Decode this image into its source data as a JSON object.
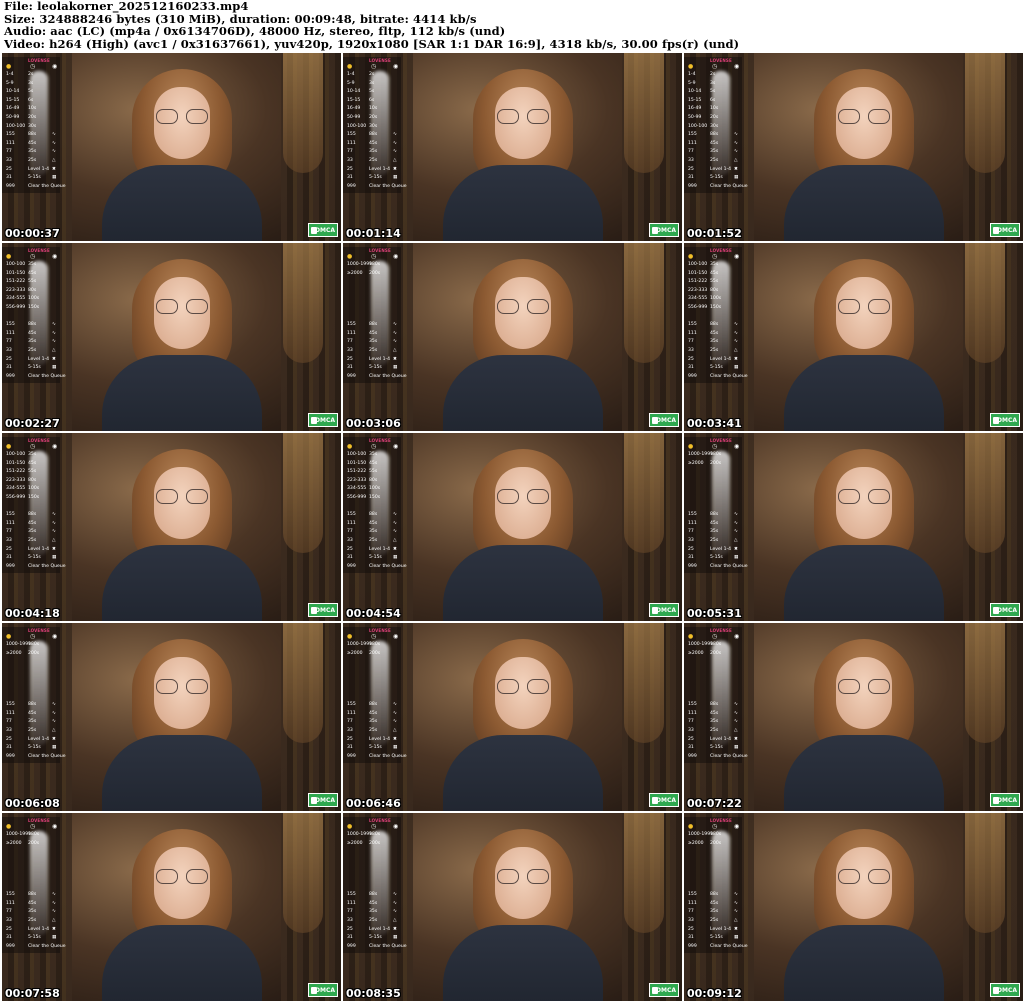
{
  "header": {
    "line1": "File: leolakorner_202512160233.mp4",
    "line2": "Size: 324888246 bytes (310 MiB), duration: 00:09:48, bitrate: 4414 kb/s",
    "line3": "Audio: aac (LC) (mp4a / 0x6134706D), 48000 Hz, stereo, fltp, 112 kb/s (und)",
    "line4": "Video: h264 (High) (avc1 / 0x31637661), yuv420p, 1920x1080 [SAR 1:1 DAR 16:9], 4318 kb/s, 30.00 fps(r) (und)"
  },
  "brand_text": "LOVENSE",
  "badge_text": "DMCA",
  "icons": {
    "coin": "coin-icon",
    "clock": "clock-icon",
    "wave": "vibe-icon",
    "lock": "lock-icon"
  },
  "colors": {
    "badge": "#2fa84f",
    "brand": "#e0407a",
    "coin": "#f2c029"
  },
  "thumbnails": [
    {
      "time": "00:00:37",
      "rows": [
        [
          "1-4",
          "2s",
          ""
        ],
        [
          "5-9",
          "3s",
          ""
        ],
        [
          "10-14",
          "5s",
          ""
        ],
        [
          "15-15",
          "6s",
          ""
        ],
        [
          "16-49",
          "10s",
          ""
        ],
        [
          "50-99",
          "20s",
          ""
        ],
        [
          "100-100",
          "30s",
          ""
        ],
        [
          "155",
          "88s",
          "∿"
        ],
        [
          "111",
          "45s",
          "∿"
        ],
        [
          "77",
          "35s",
          "∿"
        ],
        [
          "33",
          "25s",
          "△"
        ],
        [
          "25",
          "Level 1-4",
          "✖"
        ],
        [
          "31",
          "5-15s",
          "▦"
        ],
        [
          "999",
          "Clear the Queue",
          ""
        ]
      ]
    },
    {
      "time": "00:01:14",
      "rows": [
        [
          "1-4",
          "2s",
          ""
        ],
        [
          "5-9",
          "3s",
          ""
        ],
        [
          "10-14",
          "5s",
          ""
        ],
        [
          "15-15",
          "6s",
          ""
        ],
        [
          "16-49",
          "10s",
          ""
        ],
        [
          "50-99",
          "20s",
          ""
        ],
        [
          "100-100",
          "30s",
          ""
        ],
        [
          "155",
          "88s",
          "∿"
        ],
        [
          "111",
          "45s",
          "∿"
        ],
        [
          "77",
          "35s",
          "∿"
        ],
        [
          "33",
          "25s",
          "△"
        ],
        [
          "25",
          "Level 1-4",
          "✖"
        ],
        [
          "31",
          "5-15s",
          "▦"
        ],
        [
          "999",
          "Clear the Queue",
          ""
        ]
      ]
    },
    {
      "time": "00:01:52",
      "rows": [
        [
          "1-4",
          "2s",
          ""
        ],
        [
          "5-9",
          "3s",
          ""
        ],
        [
          "10-14",
          "5s",
          ""
        ],
        [
          "15-15",
          "6s",
          ""
        ],
        [
          "16-49",
          "10s",
          ""
        ],
        [
          "50-99",
          "20s",
          ""
        ],
        [
          "100-100",
          "30s",
          ""
        ],
        [
          "155",
          "88s",
          "∿"
        ],
        [
          "111",
          "45s",
          "∿"
        ],
        [
          "77",
          "35s",
          "∿"
        ],
        [
          "33",
          "25s",
          "△"
        ],
        [
          "25",
          "Level 1-4",
          "✖"
        ],
        [
          "31",
          "5-15s",
          "▦"
        ],
        [
          "999",
          "Clear the Queue",
          ""
        ]
      ]
    },
    {
      "time": "00:02:27",
      "rows": [
        [
          "100-100",
          "35s",
          ""
        ],
        [
          "101-150",
          "45s",
          ""
        ],
        [
          "151-222",
          "55s",
          ""
        ],
        [
          "223-333",
          "80s",
          ""
        ],
        [
          "334-555",
          "100s",
          ""
        ],
        [
          "556-999",
          "150s",
          ""
        ],
        [
          "",
          "",
          ""
        ],
        [
          "155",
          "88s",
          "∿"
        ],
        [
          "111",
          "45s",
          "∿"
        ],
        [
          "77",
          "35s",
          "∿"
        ],
        [
          "33",
          "25s",
          "△"
        ],
        [
          "25",
          "Level 1-4",
          "✖"
        ],
        [
          "31",
          "5-15s",
          "▦"
        ],
        [
          "999",
          "Clear the Queue",
          ""
        ]
      ]
    },
    {
      "time": "00:03:06",
      "rows": [
        [
          "1000-1999",
          "180s",
          ""
        ],
        [
          "≥2000",
          "200s",
          ""
        ],
        [
          "",
          "",
          ""
        ],
        [
          "",
          "",
          ""
        ],
        [
          "",
          "",
          ""
        ],
        [
          "",
          "",
          ""
        ],
        [
          "",
          "",
          ""
        ],
        [
          "155",
          "88s",
          "∿"
        ],
        [
          "111",
          "45s",
          "∿"
        ],
        [
          "77",
          "35s",
          "∿"
        ],
        [
          "33",
          "25s",
          "△"
        ],
        [
          "25",
          "Level 1-4",
          "✖"
        ],
        [
          "31",
          "5-15s",
          "▦"
        ],
        [
          "999",
          "Clear the Queue",
          ""
        ]
      ]
    },
    {
      "time": "00:03:41",
      "rows": [
        [
          "100-100",
          "35s",
          ""
        ],
        [
          "101-150",
          "45s",
          ""
        ],
        [
          "151-222",
          "55s",
          ""
        ],
        [
          "223-333",
          "80s",
          ""
        ],
        [
          "334-555",
          "100s",
          ""
        ],
        [
          "556-999",
          "150s",
          ""
        ],
        [
          "",
          "",
          ""
        ],
        [
          "155",
          "88s",
          "∿"
        ],
        [
          "111",
          "45s",
          "∿"
        ],
        [
          "77",
          "35s",
          "∿"
        ],
        [
          "33",
          "25s",
          "△"
        ],
        [
          "25",
          "Level 1-4",
          "✖"
        ],
        [
          "31",
          "5-15s",
          "▦"
        ],
        [
          "999",
          "Clear the Queue",
          ""
        ]
      ]
    },
    {
      "time": "00:04:18",
      "rows": [
        [
          "100-100",
          "35s",
          ""
        ],
        [
          "101-150",
          "45s",
          ""
        ],
        [
          "151-222",
          "55s",
          ""
        ],
        [
          "223-333",
          "80s",
          ""
        ],
        [
          "334-555",
          "100s",
          ""
        ],
        [
          "556-999",
          "150s",
          ""
        ],
        [
          "",
          "",
          ""
        ],
        [
          "155",
          "88s",
          "∿"
        ],
        [
          "111",
          "45s",
          "∿"
        ],
        [
          "77",
          "35s",
          "∿"
        ],
        [
          "33",
          "25s",
          "△"
        ],
        [
          "25",
          "Level 1-4",
          "✖"
        ],
        [
          "31",
          "5-15s",
          "▦"
        ],
        [
          "999",
          "Clear the Queue",
          ""
        ]
      ]
    },
    {
      "time": "00:04:54",
      "rows": [
        [
          "100-100",
          "35s",
          ""
        ],
        [
          "101-150",
          "45s",
          ""
        ],
        [
          "151-222",
          "55s",
          ""
        ],
        [
          "223-333",
          "80s",
          ""
        ],
        [
          "334-555",
          "100s",
          ""
        ],
        [
          "556-999",
          "150s",
          ""
        ],
        [
          "",
          "",
          ""
        ],
        [
          "155",
          "88s",
          "∿"
        ],
        [
          "111",
          "45s",
          "∿"
        ],
        [
          "77",
          "35s",
          "∿"
        ],
        [
          "33",
          "25s",
          "△"
        ],
        [
          "25",
          "Level 1-4",
          "✖"
        ],
        [
          "31",
          "5-15s",
          "▦"
        ],
        [
          "999",
          "Clear the Queue",
          ""
        ]
      ]
    },
    {
      "time": "00:05:31",
      "rows": [
        [
          "1000-1999",
          "180s",
          ""
        ],
        [
          "≥2000",
          "200s",
          ""
        ],
        [
          "",
          "",
          ""
        ],
        [
          "",
          "",
          ""
        ],
        [
          "",
          "",
          ""
        ],
        [
          "",
          "",
          ""
        ],
        [
          "",
          "",
          ""
        ],
        [
          "155",
          "88s",
          "∿"
        ],
        [
          "111",
          "45s",
          "∿"
        ],
        [
          "77",
          "35s",
          "∿"
        ],
        [
          "33",
          "25s",
          "△"
        ],
        [
          "25",
          "Level 1-4",
          "✖"
        ],
        [
          "31",
          "5-15s",
          "▦"
        ],
        [
          "999",
          "Clear the Queue",
          ""
        ]
      ]
    },
    {
      "time": "00:06:08",
      "rows": [
        [
          "1000-1999",
          "180s",
          ""
        ],
        [
          "≥2000",
          "200s",
          ""
        ],
        [
          "",
          "",
          ""
        ],
        [
          "",
          "",
          ""
        ],
        [
          "",
          "",
          ""
        ],
        [
          "",
          "",
          ""
        ],
        [
          "",
          "",
          ""
        ],
        [
          "155",
          "88s",
          "∿"
        ],
        [
          "111",
          "45s",
          "∿"
        ],
        [
          "77",
          "35s",
          "∿"
        ],
        [
          "33",
          "25s",
          "△"
        ],
        [
          "25",
          "Level 1-4",
          "✖"
        ],
        [
          "31",
          "5-15s",
          "▦"
        ],
        [
          "999",
          "Clear the Queue",
          ""
        ]
      ]
    },
    {
      "time": "00:06:46",
      "rows": [
        [
          "1000-1999",
          "180s",
          ""
        ],
        [
          "≥2000",
          "200s",
          ""
        ],
        [
          "",
          "",
          ""
        ],
        [
          "",
          "",
          ""
        ],
        [
          "",
          "",
          ""
        ],
        [
          "",
          "",
          ""
        ],
        [
          "",
          "",
          ""
        ],
        [
          "155",
          "88s",
          "∿"
        ],
        [
          "111",
          "45s",
          "∿"
        ],
        [
          "77",
          "35s",
          "∿"
        ],
        [
          "33",
          "25s",
          "△"
        ],
        [
          "25",
          "Level 1-4",
          "✖"
        ],
        [
          "31",
          "5-15s",
          "▦"
        ],
        [
          "999",
          "Clear the Queue",
          ""
        ]
      ]
    },
    {
      "time": "00:07:22",
      "rows": [
        [
          "1000-1999",
          "180s",
          ""
        ],
        [
          "≥2000",
          "200s",
          ""
        ],
        [
          "",
          "",
          ""
        ],
        [
          "",
          "",
          ""
        ],
        [
          "",
          "",
          ""
        ],
        [
          "",
          "",
          ""
        ],
        [
          "",
          "",
          ""
        ],
        [
          "155",
          "88s",
          "∿"
        ],
        [
          "111",
          "45s",
          "∿"
        ],
        [
          "77",
          "35s",
          "∿"
        ],
        [
          "33",
          "25s",
          "△"
        ],
        [
          "25",
          "Level 1-4",
          "✖"
        ],
        [
          "31",
          "5-15s",
          "▦"
        ],
        [
          "999",
          "Clear the Queue",
          ""
        ]
      ]
    },
    {
      "time": "00:07:58",
      "rows": [
        [
          "1000-1999",
          "180s",
          ""
        ],
        [
          "≥2000",
          "200s",
          ""
        ],
        [
          "",
          "",
          ""
        ],
        [
          "",
          "",
          ""
        ],
        [
          "",
          "",
          ""
        ],
        [
          "",
          "",
          ""
        ],
        [
          "",
          "",
          ""
        ],
        [
          "155",
          "88s",
          "∿"
        ],
        [
          "111",
          "45s",
          "∿"
        ],
        [
          "77",
          "35s",
          "∿"
        ],
        [
          "33",
          "25s",
          "△"
        ],
        [
          "25",
          "Level 1-4",
          "✖"
        ],
        [
          "31",
          "5-15s",
          "▦"
        ],
        [
          "999",
          "Clear the Queue",
          ""
        ]
      ]
    },
    {
      "time": "00:08:35",
      "rows": [
        [
          "1000-1999",
          "180s",
          ""
        ],
        [
          "≥2000",
          "200s",
          ""
        ],
        [
          "",
          "",
          ""
        ],
        [
          "",
          "",
          ""
        ],
        [
          "",
          "",
          ""
        ],
        [
          "",
          "",
          ""
        ],
        [
          "",
          "",
          ""
        ],
        [
          "155",
          "88s",
          "∿"
        ],
        [
          "111",
          "45s",
          "∿"
        ],
        [
          "77",
          "35s",
          "∿"
        ],
        [
          "33",
          "25s",
          "△"
        ],
        [
          "25",
          "Level 1-4",
          "✖"
        ],
        [
          "31",
          "5-15s",
          "▦"
        ],
        [
          "999",
          "Clear the Queue",
          ""
        ]
      ]
    },
    {
      "time": "00:09:12",
      "rows": [
        [
          "1000-1999",
          "180s",
          ""
        ],
        [
          "≥2000",
          "200s",
          ""
        ],
        [
          "",
          "",
          ""
        ],
        [
          "",
          "",
          ""
        ],
        [
          "",
          "",
          ""
        ],
        [
          "",
          "",
          ""
        ],
        [
          "",
          "",
          ""
        ],
        [
          "155",
          "88s",
          "∿"
        ],
        [
          "111",
          "45s",
          "∿"
        ],
        [
          "77",
          "35s",
          "∿"
        ],
        [
          "33",
          "25s",
          "△"
        ],
        [
          "25",
          "Level 1-4",
          "✖"
        ],
        [
          "31",
          "5-15s",
          "▦"
        ],
        [
          "999",
          "Clear the Queue",
          ""
        ]
      ]
    }
  ]
}
